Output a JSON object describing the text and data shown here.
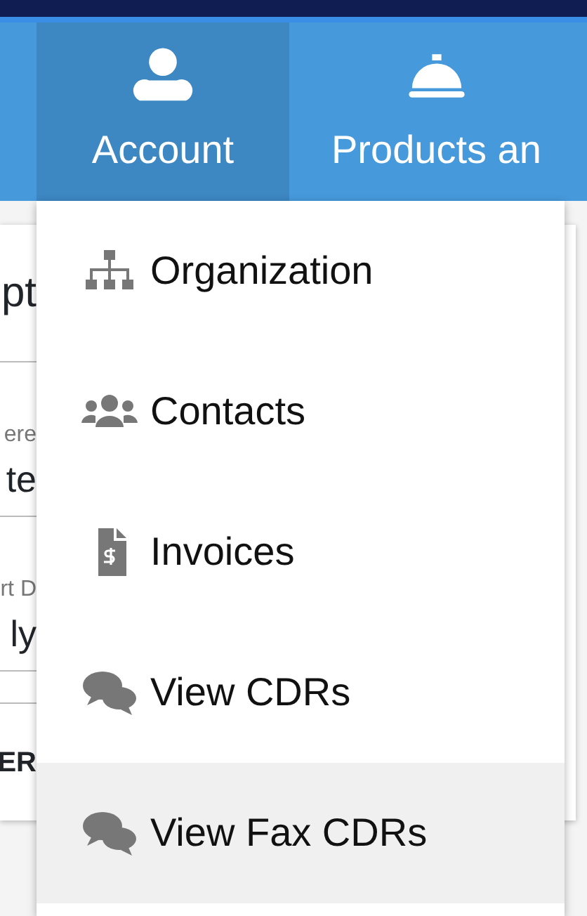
{
  "nav_tabs": [
    {
      "label": "Account",
      "selected": true
    },
    {
      "label": "Products an",
      "selected": false
    }
  ],
  "account_menu": [
    {
      "label": "Organization",
      "selected": false
    },
    {
      "label": "Contacts",
      "selected": false
    },
    {
      "label": "Invoices",
      "selected": false
    },
    {
      "label": "View CDRs",
      "selected": false
    },
    {
      "label": "View Fax CDRs",
      "selected": true
    }
  ],
  "background_card": {
    "title": "pt",
    "fields": [
      {
        "label": "ere",
        "value": "te"
      },
      {
        "label": "rt D",
        "value": "ly"
      }
    ],
    "table_header": "ER"
  }
}
